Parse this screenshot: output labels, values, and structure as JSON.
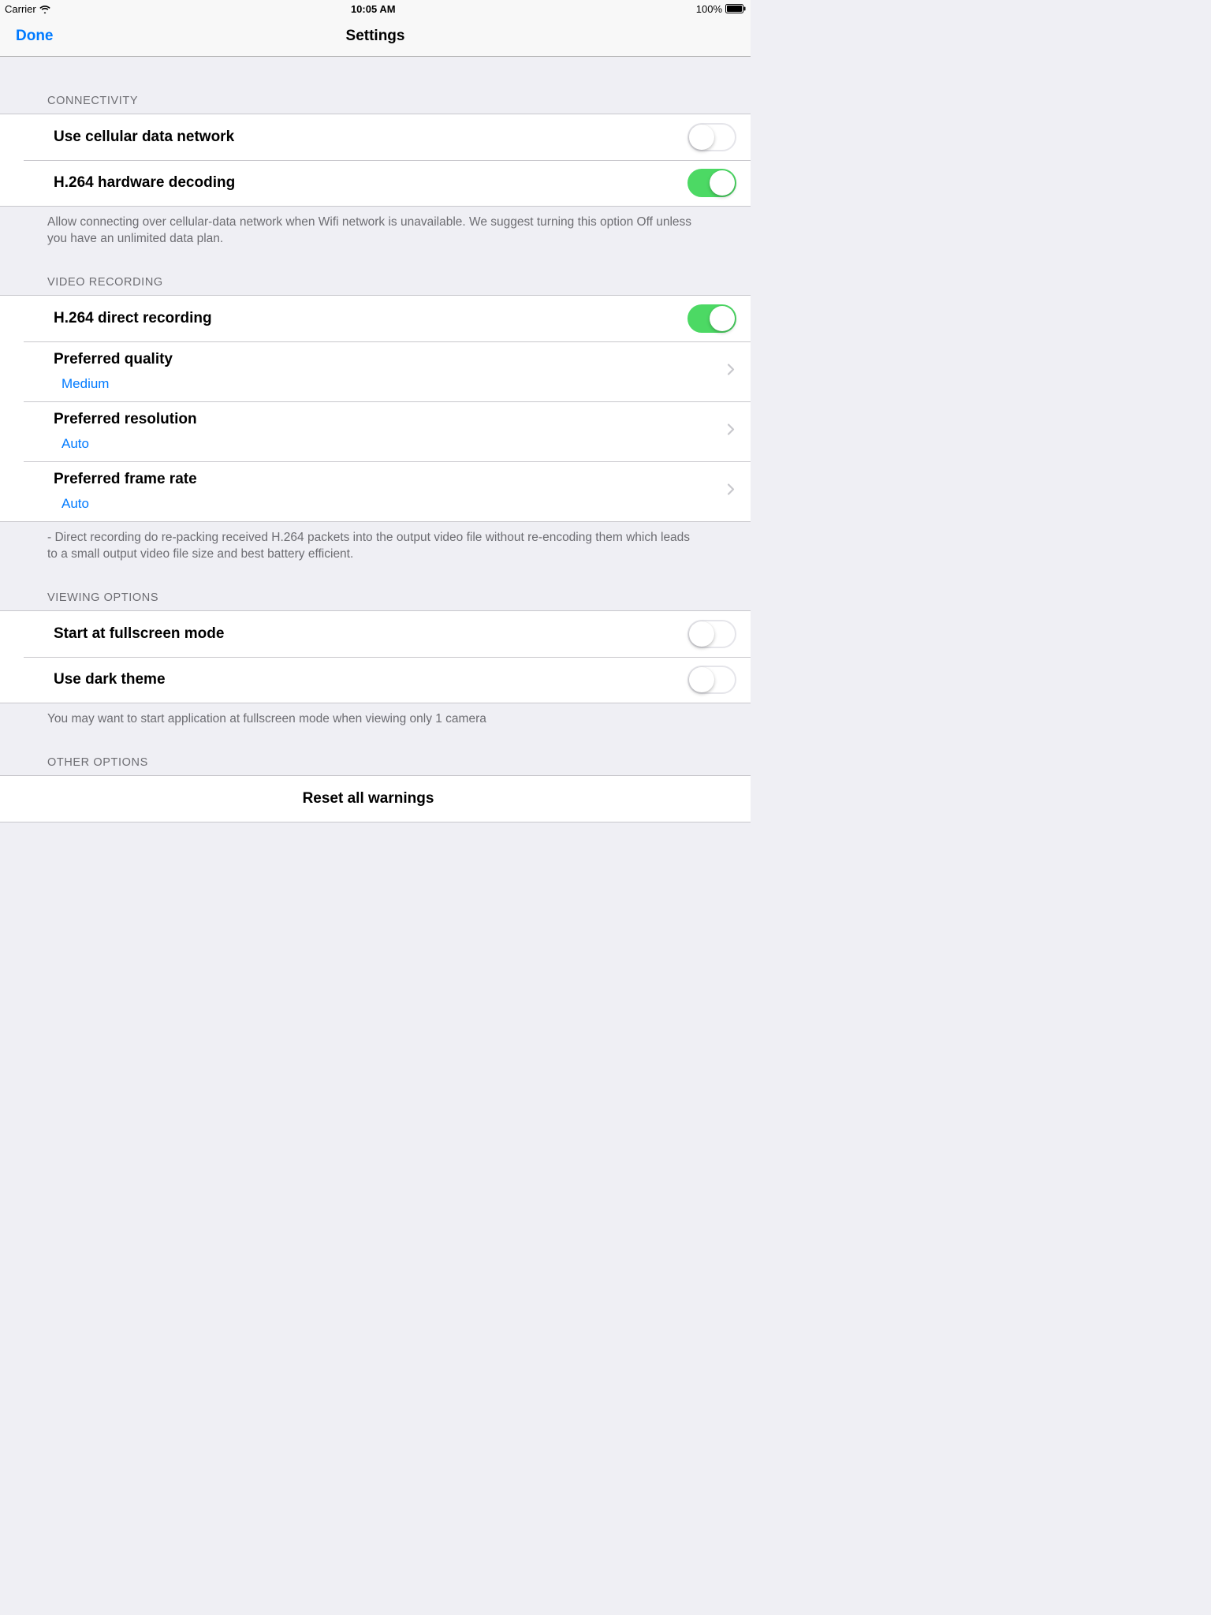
{
  "status": {
    "carrier": "Carrier",
    "time": "10:05 AM",
    "battery_pct": "100%"
  },
  "nav": {
    "done": "Done",
    "title": "Settings"
  },
  "sections": {
    "connectivity": {
      "header": "Connectivity",
      "cellular_label": "Use cellular data network",
      "cellular_on": false,
      "h264hw_label": "H.264 hardware decoding",
      "h264hw_on": true,
      "footer": "Allow connecting over cellular-data network when Wifi network is unavailable. We suggest turning this option Off unless you have an unlimited data plan."
    },
    "video": {
      "header": "Video recording",
      "direct_label": "H.264 direct recording",
      "direct_on": true,
      "quality_label": "Preferred quality",
      "quality_value": "Medium",
      "resolution_label": "Preferred resolution",
      "resolution_value": "Auto",
      "framerate_label": "Preferred frame rate",
      "framerate_value": "Auto",
      "footer": "- Direct recording do re-packing received H.264 packets into the output video file without re-encoding them which leads to a small output video file size and best battery efficient."
    },
    "viewing": {
      "header": "Viewing options",
      "fullscreen_label": "Start at fullscreen mode",
      "fullscreen_on": false,
      "dark_label": "Use dark theme",
      "dark_on": false,
      "footer": "You may want to start application at fullscreen mode when viewing only 1 camera"
    },
    "other": {
      "header": "Other options",
      "reset_label": "Reset all warnings"
    }
  }
}
